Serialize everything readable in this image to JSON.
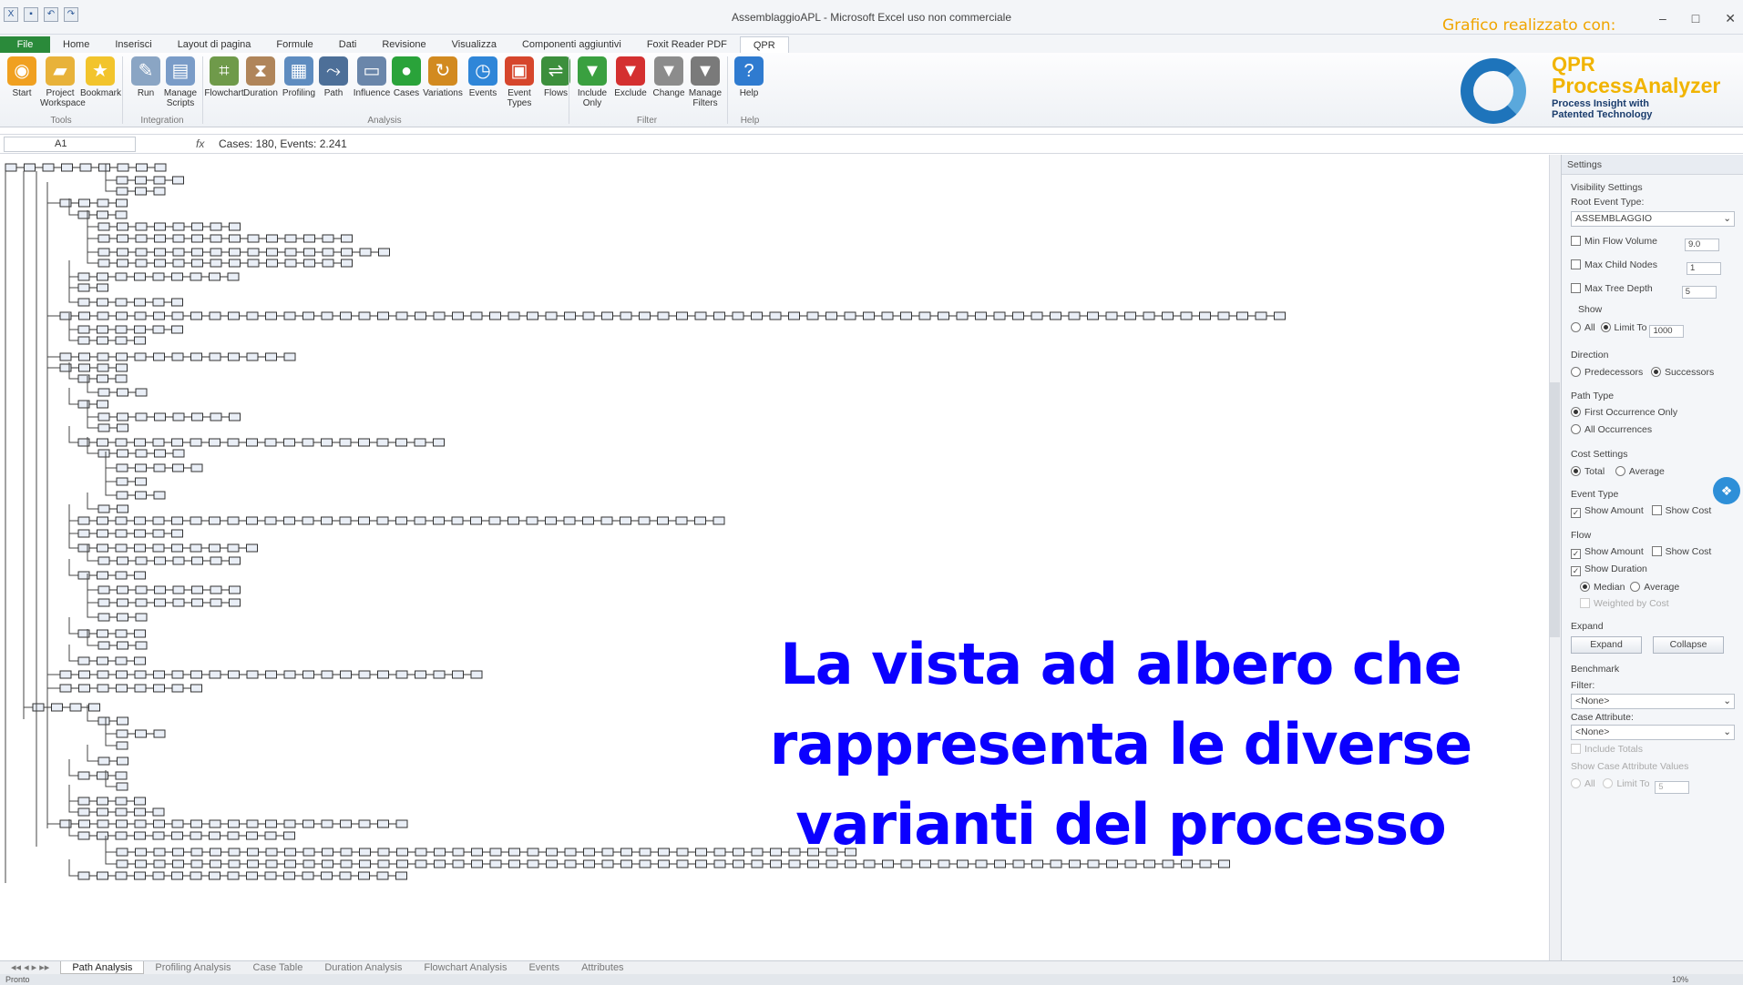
{
  "titlebar": {
    "window_title": "AssemblaggioAPL - Microsoft Excel uso non commerciale",
    "credit": "Grafico realizzato con:",
    "quick_access": [
      "save-icon",
      "undo-icon",
      "redo-icon"
    ],
    "window_controls": [
      "–",
      "□",
      "✕"
    ]
  },
  "tabs": [
    "File",
    "Home",
    "Inserisci",
    "Layout di pagina",
    "Formule",
    "Dati",
    "Revisione",
    "Visualizza",
    "Componenti aggiuntivi",
    "Foxit Reader PDF",
    "QPR"
  ],
  "active_tab": "QPR",
  "ribbon": {
    "buttons": [
      {
        "label": "Start",
        "icon": "start-icon",
        "color": "#f0a020"
      },
      {
        "label": "Project Workspace",
        "icon": "folder-icon",
        "color": "#e8b23a"
      },
      {
        "label": "Bookmark",
        "icon": "star-icon",
        "color": "#f2c42c"
      },
      {
        "label": "Run",
        "icon": "wand-icon",
        "color": "#8aa5c4"
      },
      {
        "label": "Manage Scripts",
        "icon": "scripts-icon",
        "color": "#7a9cc8"
      },
      {
        "label": "Flowchart",
        "icon": "flowchart-icon",
        "color": "#6f9a4a"
      },
      {
        "label": "Duration",
        "icon": "hourglass-icon",
        "color": "#b0855a"
      },
      {
        "label": "Profiling",
        "icon": "table-icon",
        "color": "#5e8cc0"
      },
      {
        "label": "Path",
        "icon": "path-icon",
        "color": "#4d6f98"
      },
      {
        "label": "Influence",
        "icon": "influence-icon",
        "color": "#6a86aa"
      },
      {
        "label": "Cases",
        "icon": "cases-icon",
        "color": "#2aa33a"
      },
      {
        "label": "Variations",
        "icon": "variations-icon",
        "color": "#d28a20"
      },
      {
        "label": "Events",
        "icon": "clock-icon",
        "color": "#2f86d8"
      },
      {
        "label": "Event Types",
        "icon": "event-types-icon",
        "color": "#d6462c"
      },
      {
        "label": "Flows",
        "icon": "flows-icon",
        "color": "#3c8f3c"
      },
      {
        "label": "Include Only",
        "icon": "filter-include-icon",
        "color": "#3aa040"
      },
      {
        "label": "Exclude",
        "icon": "filter-exclude-icon",
        "color": "#d43030"
      },
      {
        "label": "Change",
        "icon": "filter-change-icon",
        "color": "#8c8c8c"
      },
      {
        "label": "Manage Filters",
        "icon": "filter-manage-icon",
        "color": "#7a7a7a"
      },
      {
        "label": "Help",
        "icon": "help-icon",
        "color": "#2f7bd0"
      }
    ],
    "groups": [
      "Tools",
      "Integration",
      "Analysis",
      "Filter",
      "Help"
    ]
  },
  "logo": {
    "line1": "QPR",
    "line2": "ProcessAnalyzer",
    "line3": "Process Insight with",
    "line4": "Patented Technology"
  },
  "formula_bar": {
    "cell": "A1",
    "fx": "fx",
    "value": "Cases: 180, Events: 2.241"
  },
  "panel": {
    "title": "Settings",
    "visibility_settings": "Visibility Settings",
    "root_event_type_label": "Root Event Type:",
    "root_event_type_value": "ASSEMBLAGGIO",
    "min_flow_volume": {
      "label": "Min Flow Volume",
      "value": "9.0"
    },
    "max_child_nodes": {
      "label": "Max Child Nodes",
      "value": "1"
    },
    "max_tree_depth": {
      "label": "Max Tree Depth",
      "value": "5"
    },
    "show_label": "Show",
    "show_all": "All",
    "show_limit": "Limit To",
    "show_limit_value": "1000",
    "direction_label": "Direction",
    "predecessors": "Predecessors",
    "successors": "Successors",
    "path_type_label": "Path Type",
    "first_occurrence": "First Occurrence Only",
    "all_occurrences": "All Occurrences",
    "cost_settings_label": "Cost Settings",
    "total": "Total",
    "average": "Average",
    "event_type_label": "Event Type",
    "show_amount": "Show Amount",
    "show_cost": "Show Cost",
    "flow_label": "Flow",
    "show_duration": "Show Duration",
    "median": "Median",
    "weighted_by_cost": "Weighted by Cost",
    "expand_label": "Expand",
    "expand_button": "Expand",
    "collapse_button": "Collapse",
    "benchmark_label": "Benchmark",
    "filter_label": "Filter:",
    "filter_value": "<None>",
    "case_attribute_label": "Case Attribute:",
    "case_attribute_value": "<None>",
    "include_totals": "Include Totals",
    "show_case_attribute_values": "Show Case Attribute Values",
    "limit_value": "5"
  },
  "sheet_tabs": [
    "Path Analysis",
    "Profiling Analysis",
    "Case Table",
    "Duration Analysis",
    "Flowchart Analysis",
    "Events",
    "Attributes"
  ],
  "active_sheet": "Path Analysis",
  "status": {
    "ready": "Pronto",
    "zoom": "10%"
  },
  "overlay_text": [
    "La vista ad albero che",
    "rappresenta le diverse",
    "varianti del processo"
  ]
}
